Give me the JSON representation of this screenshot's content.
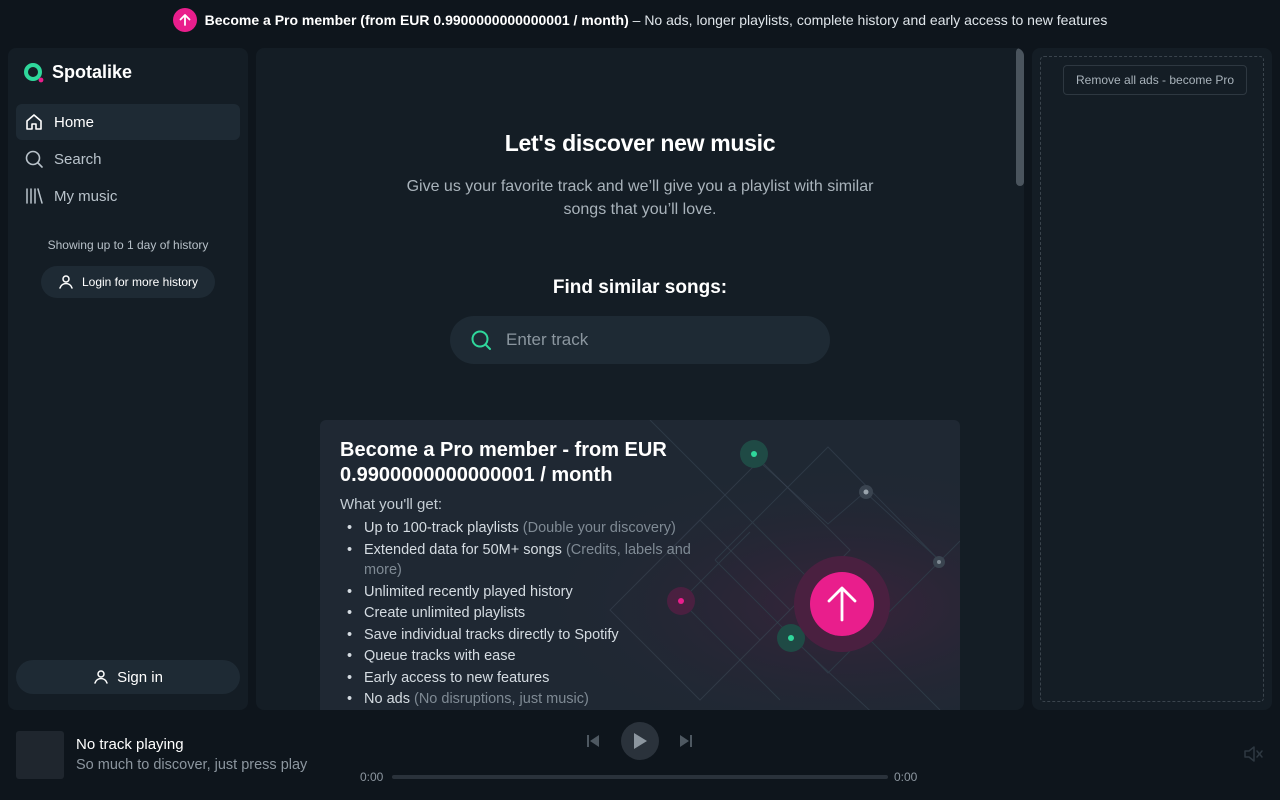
{
  "banner": {
    "bold": "Become a Pro member (from EUR 0.9900000000000001 / month)",
    "rest": "– No ads, longer playlists, complete history and early access to new features",
    "icon": "arrow-up-icon"
  },
  "sidebar": {
    "logo_text": "Spotalike",
    "items": [
      {
        "label": "Home",
        "icon": "home-icon",
        "active": true
      },
      {
        "label": "Search",
        "icon": "search-icon",
        "active": false
      },
      {
        "label": "My music",
        "icon": "library-icon",
        "active": false
      }
    ],
    "history_note": "Showing up to 1 day of history",
    "login_label": "Login for more history",
    "signin_label": "Sign in"
  },
  "main": {
    "hero_title": "Let's discover new music",
    "hero_sub": "Give us your favorite track and we’ll give you a playlist with similar songs that you’ll love.",
    "find_title": "Find similar songs:",
    "search_placeholder": "Enter track",
    "pro_card": {
      "title": "Become a Pro member - from EUR 0.9900000000000001 / month",
      "what_you_get": "What you'll get:",
      "features": [
        {
          "text": "Up to 100-track playlists",
          "note": "(Double your discovery)"
        },
        {
          "text": "Extended data for 50M+ songs",
          "note": "(Credits, labels and more)"
        },
        {
          "text": "Unlimited recently played history",
          "note": ""
        },
        {
          "text": "Create unlimited playlists",
          "note": ""
        },
        {
          "text": "Save individual tracks directly to Spotify",
          "note": ""
        },
        {
          "text": "Queue tracks with ease",
          "note": ""
        },
        {
          "text": "Early access to new features",
          "note": ""
        },
        {
          "text": "No ads",
          "note": "(No disruptions, just music)"
        }
      ]
    }
  },
  "right_panel": {
    "remove_ads_label": "Remove all ads - become Pro"
  },
  "player": {
    "title": "No track playing",
    "subtitle": "So much to discover, just press play",
    "time_elapsed": "0:00",
    "time_total": "0:00",
    "progress": 0
  },
  "colors": {
    "accent_pink": "#e91e8c",
    "accent_green": "#2fd79b",
    "background": "#0e151c",
    "panel": "#141d25"
  }
}
